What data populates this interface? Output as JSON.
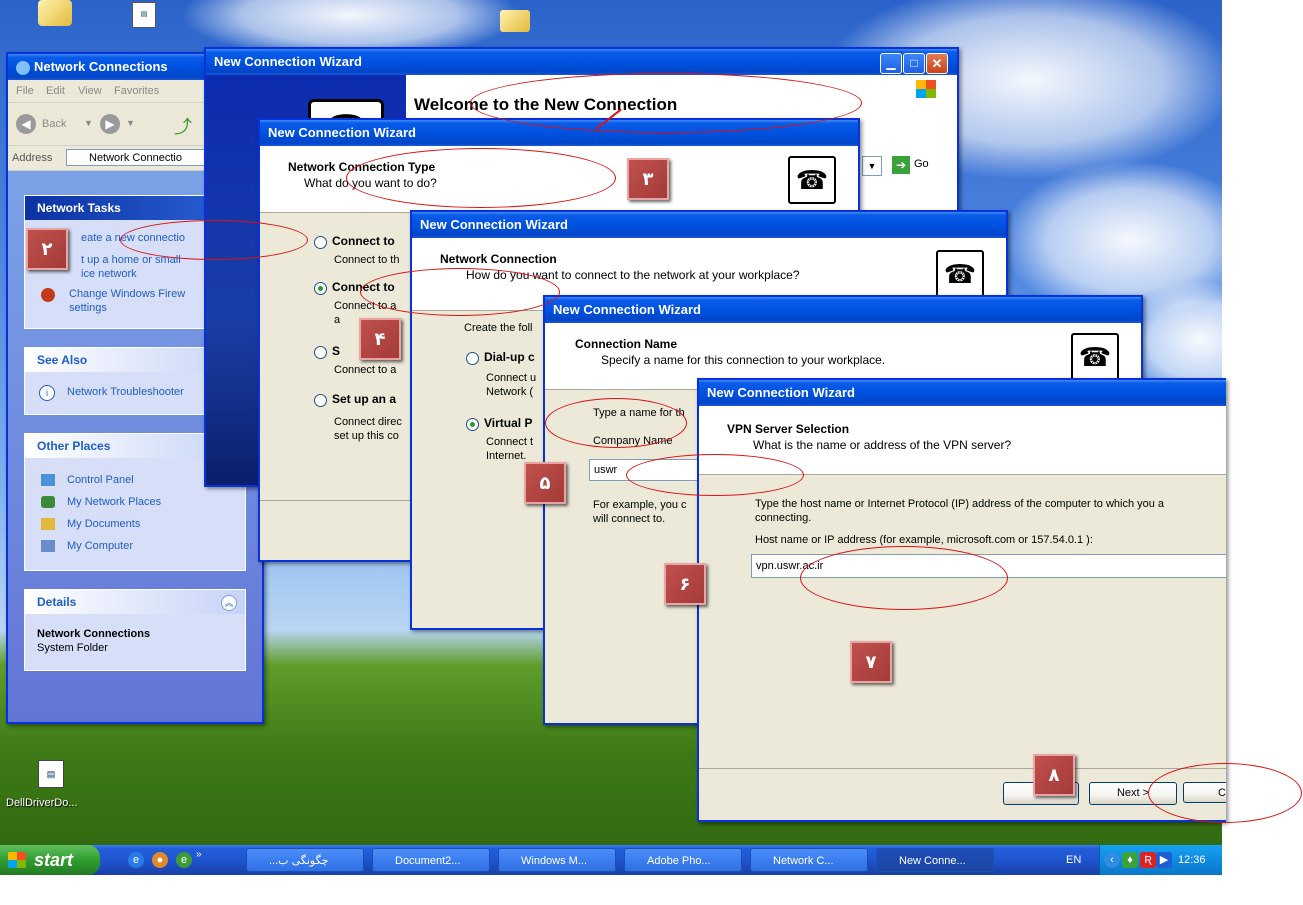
{
  "desktop": {
    "icon_label": "DellDriverDo..."
  },
  "network_connections": {
    "title": "Network Connections",
    "menu": [
      "File",
      "Edit",
      "View",
      "Favorites"
    ],
    "back": "Back",
    "address_label": "Address",
    "address_value": "Network Connectio",
    "go": "Go",
    "network_tasks": {
      "header": "Network Tasks",
      "items": [
        "eate a new connectio",
        "t up a home or small",
        "ice network",
        "Change Windows Firew",
        "settings"
      ]
    },
    "see_also": {
      "header": "See Also",
      "items": [
        "Network Troubleshooter"
      ]
    },
    "other_places": {
      "header": "Other Places",
      "items": [
        "Control Panel",
        "My Network Places",
        "My Documents",
        "My Computer"
      ]
    },
    "details": {
      "header": "Details",
      "name": "Network Connections",
      "type": "System Folder"
    }
  },
  "wizard1": {
    "title": "New Connection Wizard",
    "welcome": "Welcome to the New Connection"
  },
  "wizard2": {
    "title": "New Connection Wizard",
    "heading": "Network Connection Type",
    "subheading": "What do you want to do?",
    "opt1": "Connect to",
    "opt1_desc": "Connect to th",
    "opt2": "Connect to",
    "opt2_desc1": "Connect to a",
    "opt2_desc2": "a",
    "opt3": "S",
    "opt3_desc": "Connect to a",
    "opt4": "Set up an a",
    "opt4_desc1": "Connect direc",
    "opt4_desc2": "set up this co"
  },
  "wizard3": {
    "title": "New Connection Wizard",
    "heading": "Network Connection",
    "subheading": "How do you want to connect to the network at your workplace?",
    "create": "Create the foll",
    "opt1": "Dial-up c",
    "opt1_desc1": "Connect u",
    "opt1_desc2": "Network (",
    "opt2": "Virtual P",
    "opt2_desc1": "Connect t",
    "opt2_desc2": "Internet."
  },
  "wizard4": {
    "title": "New Connection Wizard",
    "heading": "Connection Name",
    "subheading": "Specify a name for this connection to your workplace.",
    "type_name": "Type a name for th",
    "company_label": "Company Name",
    "company_value": "uswr",
    "example1": "For example, you c",
    "example2": "will connect to."
  },
  "wizard5": {
    "title": "New Connection Wizard",
    "heading": "VPN Server Selection",
    "subheading": "What is the name or address of the VPN server?",
    "instruction1": "Type the host name or Internet Protocol (IP) address of the computer to which you a",
    "instruction2": "connecting.",
    "host_label": "Host name or IP address (for example, microsoft.com or 157.54.0.1 ):",
    "host_value": "vpn.uswr.ac.ir",
    "next": "Next >",
    "cancel": "C"
  },
  "annotations": [
    "۲",
    "۳",
    "۴",
    "۵",
    "۶",
    "۷",
    "۸"
  ],
  "taskbar": {
    "start": "start",
    "buttons": [
      "...چگونگی ب",
      "Document2...",
      "Windows M...",
      "Adobe Pho...",
      "Network C...",
      "New Conne..."
    ],
    "lang": "EN",
    "clock": "12:36 PM"
  },
  "colors": {
    "xp_blue": "#0a5ce8",
    "annotation_red": "#c0504d",
    "oval_red": "#dd1111"
  }
}
